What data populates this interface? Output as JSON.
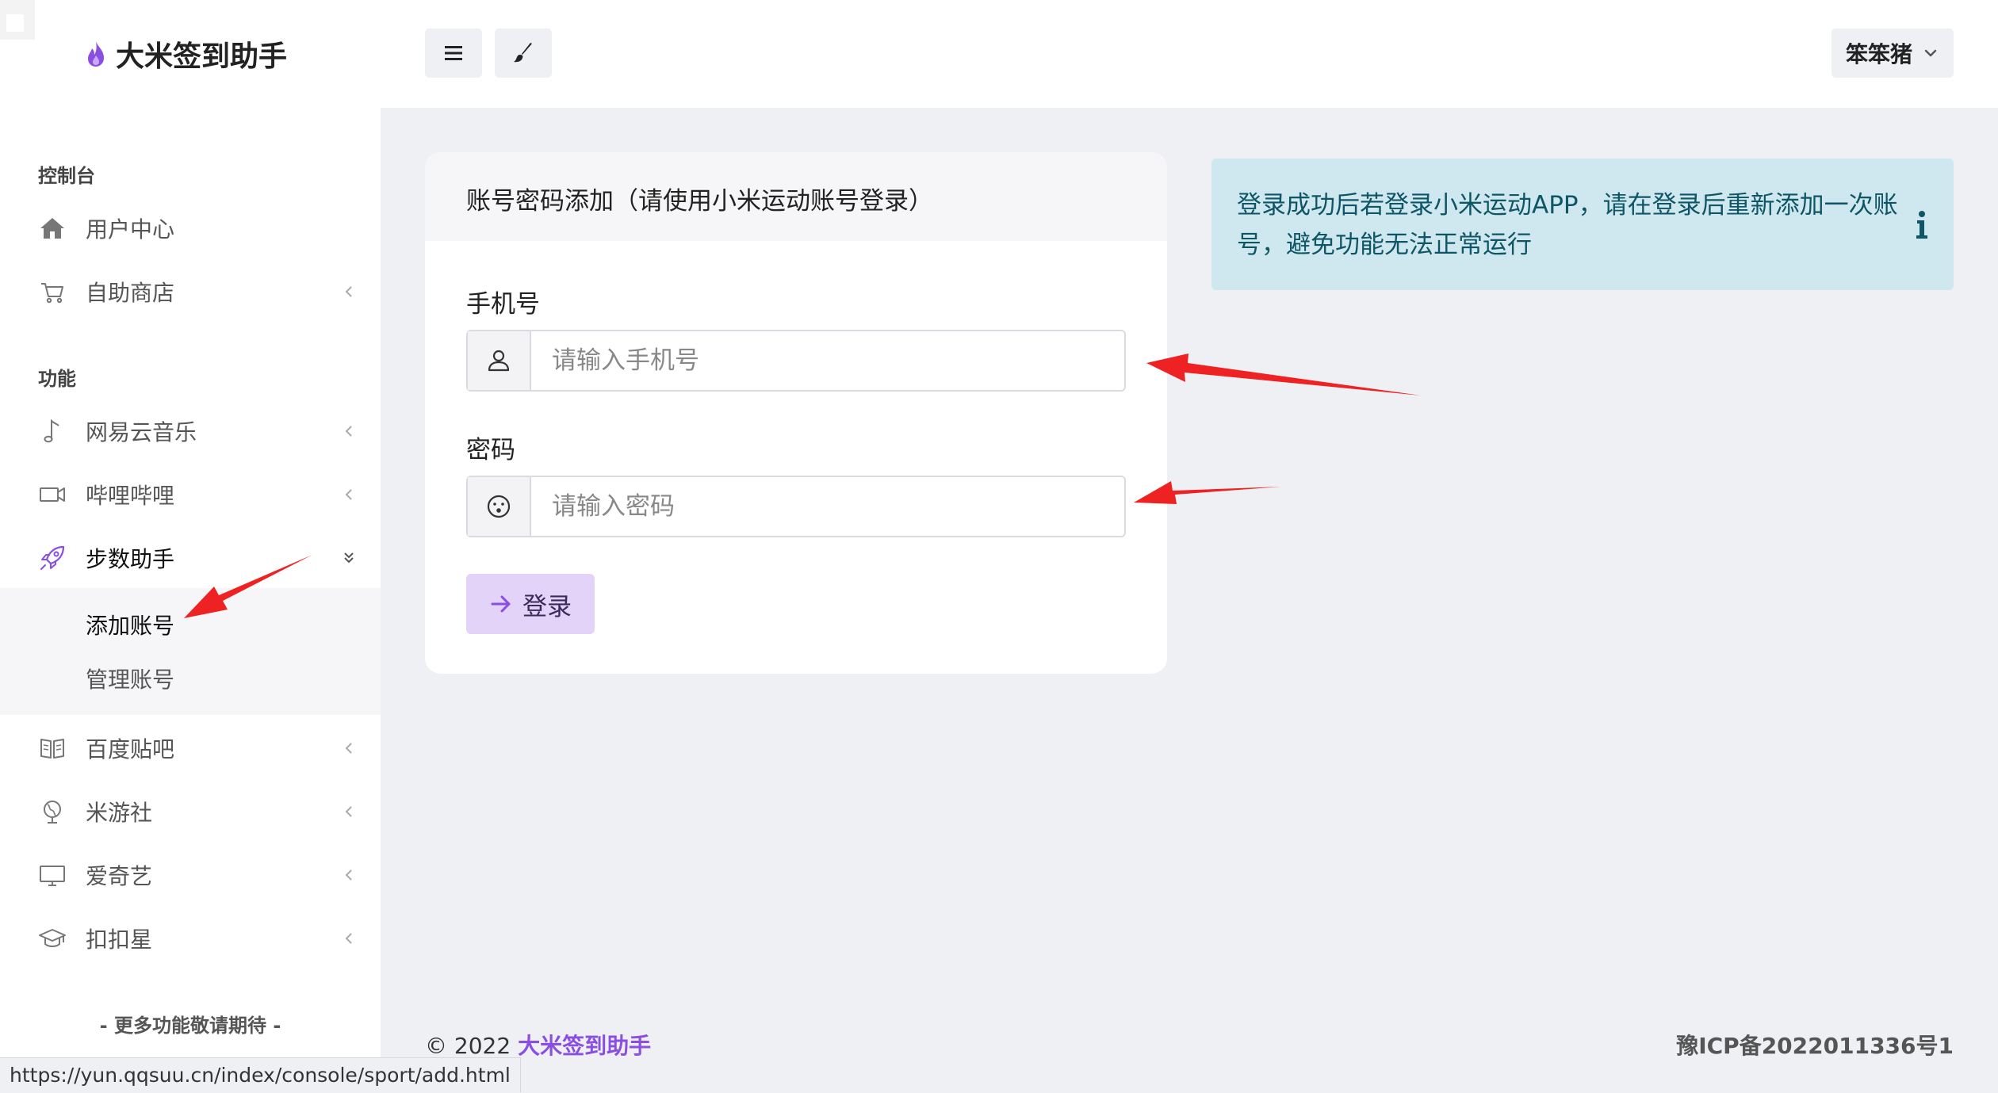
{
  "header": {
    "brand": "大米签到助手",
    "user_name": "笨笨猪"
  },
  "sidebar": {
    "sections": [
      {
        "title": "控制台"
      },
      {
        "title": "功能"
      }
    ],
    "items": [
      {
        "label": "用户中心",
        "icon": "home-icon"
      },
      {
        "label": "自助商店",
        "icon": "cart-icon"
      },
      {
        "label": "网易云音乐",
        "icon": "music-note-icon"
      },
      {
        "label": "哔哩哔哩",
        "icon": "video-camera-icon"
      },
      {
        "label": "步数助手",
        "icon": "rocket-icon",
        "expanded": true
      },
      {
        "label": "百度贴吧",
        "icon": "book-icon"
      },
      {
        "label": "米游社",
        "icon": "globe-icon"
      },
      {
        "label": "爱奇艺",
        "icon": "monitor-icon"
      },
      {
        "label": "扣扣星",
        "icon": "graduation-cap-icon"
      }
    ],
    "submenu": [
      {
        "label": "添加账号",
        "active": true
      },
      {
        "label": "管理账号"
      }
    ],
    "footer": "- 更多功能敬请期待 -"
  },
  "form": {
    "title": "账号密码添加（请使用小米运动账号登录）",
    "phone_label": "手机号",
    "phone_placeholder": "请输入手机号",
    "password_label": "密码",
    "password_placeholder": "请输入密码",
    "submit_label": "登录"
  },
  "alert": {
    "text": "登录成功后若登录小米运动APP，请在登录后重新添加一次账号，避免功能无法正常运行"
  },
  "footer": {
    "copyright_prefix": "© 2022",
    "brand": "大米签到助手",
    "icp": "豫ICP备2022011336号1"
  },
  "status_bar": {
    "url": "https://yun.qqsuu.cn/index/console/sport/add.html"
  },
  "colors": {
    "accent": "#8a4fe0",
    "button_bg": "#e3d3f9",
    "alert_bg": "#cfe8ef",
    "alert_text": "#0e5566",
    "annotation_arrow": "#ee2222"
  }
}
